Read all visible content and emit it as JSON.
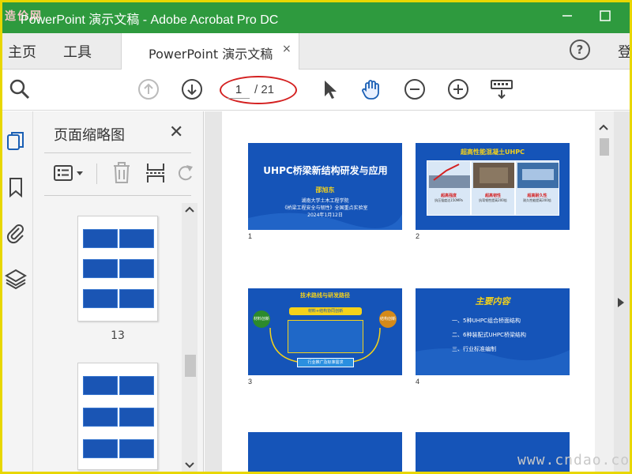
{
  "titlebar": {
    "logo": "造价网",
    "title": "PowerPoint 演示文稿 - Adobe Acrobat Pro DC",
    "minimize_icon": "minimize-icon",
    "maximize_icon": "maximize-icon"
  },
  "menubar": {
    "home": "主页",
    "tools": "工具",
    "tab_label": "PowerPoint 演示文稿",
    "tab_close": "×",
    "help": "?",
    "login": "登"
  },
  "toolbar": {
    "current_page": "1",
    "total_pages": "/ 21",
    "icons": [
      "search-zoom-icon",
      "page-up-icon",
      "page-down-icon",
      "select-cursor-icon",
      "hand-tool-icon",
      "zoom-out-icon",
      "zoom-in-icon",
      "keyboard-icon"
    ],
    "highlight_color": "#d42020"
  },
  "left_rail": {
    "icons": [
      "page-thumbnails-icon",
      "bookmark-icon",
      "attachment-icon",
      "layers-icon"
    ]
  },
  "thumbnail_panel": {
    "title": "页面缩略图",
    "close": "✕",
    "tools": [
      "thumbnail-options-icon",
      "delete-page-icon",
      "extract-page-icon",
      "rotate-page-icon"
    ],
    "pages": [
      {
        "label": "13"
      },
      {
        "label": ""
      }
    ]
  },
  "document": {
    "slides": [
      {
        "number": "1",
        "title": "UHPC桥梁新结构研发与应用",
        "author": "邵旭东",
        "lines": [
          "湖南大学土木工程学院",
          "《桥梁工程安全与韧性》全国重点实验室",
          "2024年1月12日"
        ]
      },
      {
        "number": "2",
        "title": "超高性能混凝土UHPC",
        "panels": [
          {
            "label": "超高强度",
            "text": "抗压强度达150MPa"
          },
          {
            "label": "超高韧性",
            "text": "抗弯韧性提高200倍"
          },
          {
            "label": "超高耐久性",
            "text": "耐久性能提高200倍"
          }
        ]
      },
      {
        "number": "3",
        "title": "技术路线与研发路径",
        "center": "材料+结构协同创新",
        "left": "材料创新",
        "right": "结构创新",
        "bottom": "行业推广及标准需求"
      },
      {
        "number": "4",
        "title": "主要内容",
        "items": [
          "一、5种UHPC组合桥面结构",
          "二、6种装配式UHPC桥梁结构",
          "三、行业标准编制"
        ]
      }
    ]
  },
  "watermark": "www.cndao.com",
  "colors": {
    "titlebar": "#2e9a3e",
    "slide_blue": "#1554b8",
    "accent_yellow": "#f5d21a",
    "frame_yellow": "#e8d700"
  }
}
